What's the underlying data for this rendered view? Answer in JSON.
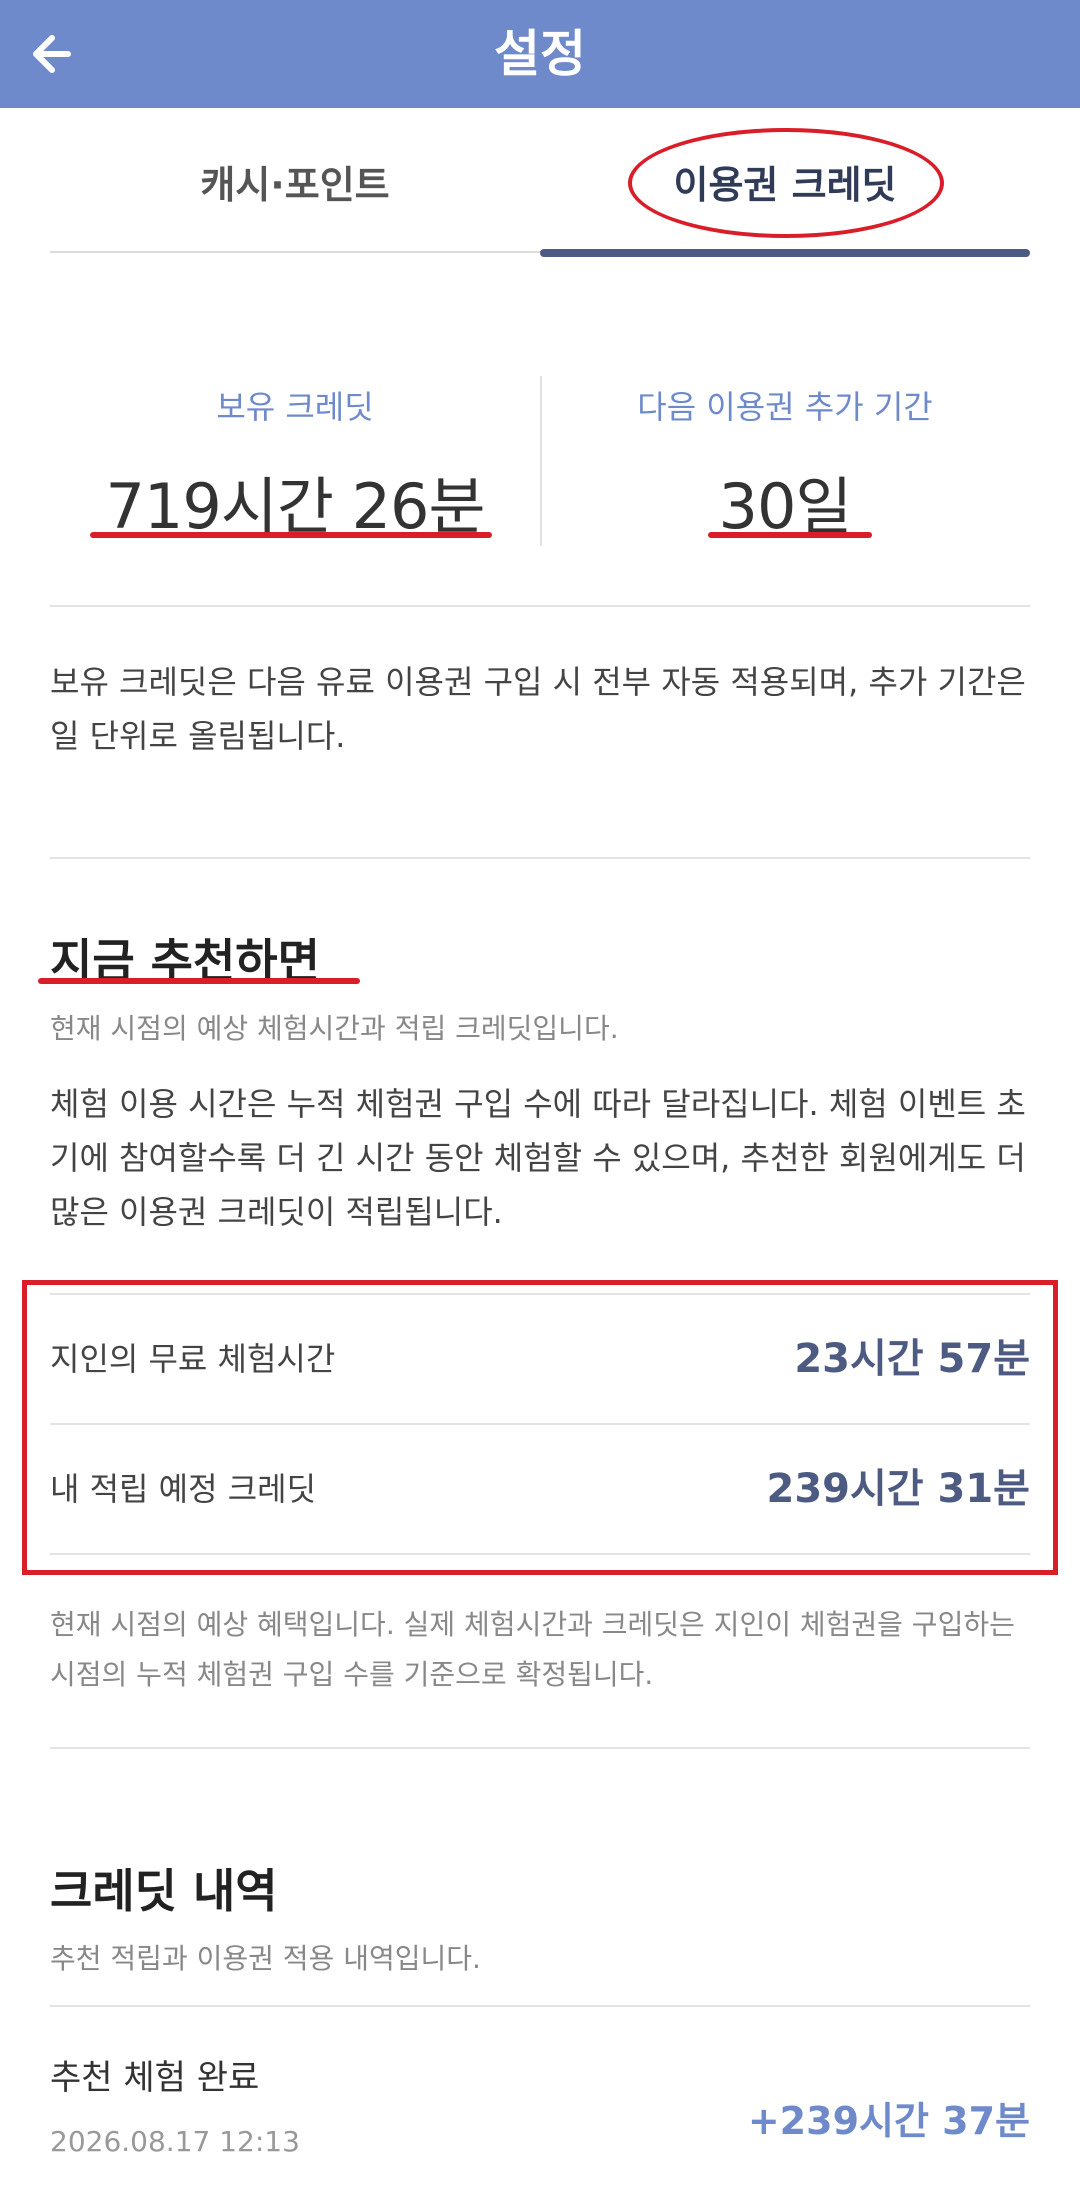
{
  "header": {
    "title": "설정",
    "back_icon": "arrow-left-icon"
  },
  "tabs": [
    {
      "label": "캐시·포인트",
      "selected": false
    },
    {
      "label": "이용권 크레딧",
      "selected": true
    }
  ],
  "summary": {
    "credit_label": "보유 크레딧",
    "credit_value": "719시간 26분",
    "period_label": "다음 이용권 추가 기간",
    "period_value": "30일"
  },
  "credit_notice": "보유 크레딧은 다음 유료 이용권 구입 시 전부 자동 적용되며, 추가 기간은 일 단위로 올림됩니다.",
  "recommend": {
    "title": "지금 추천하면",
    "subtitle": "현재 시점의 예상 체험시간과 적립 크레딧입니다.",
    "description": "체험 이용 시간은 누적 체험권 구입 수에 따라 달라집니다. 체험 이벤트 초기에 참여할수록 더 긴 시간 동안 체험할 수 있으며, 추천한 회원에게도 더 많은 이용권 크레딧이 적립됩니다.",
    "rows": [
      {
        "label": "지인의 무료 체험시간",
        "value": "23시간 57분"
      },
      {
        "label": "내 적립 예정 크레딧",
        "value": "239시간 31분"
      }
    ],
    "footnote": "현재 시점의 예상 혜택입니다. 실제 체험시간과 크레딧은 지인이 체험권을 구입하는 시점의 누적 체험권 구입 수를 기준으로 확정됩니다."
  },
  "history": {
    "title": "크레딧 내역",
    "subtitle": "추천 적립과 이용권 적용 내역입니다.",
    "items": [
      {
        "title": "추천 체험 완료",
        "date": "2026.08.17 12:13",
        "amount": "+239시간 37분"
      }
    ]
  },
  "colors": {
    "appbar": "#6f8acb",
    "accent_dark": "#4d5a82",
    "annotation_red": "#d91e2a"
  }
}
